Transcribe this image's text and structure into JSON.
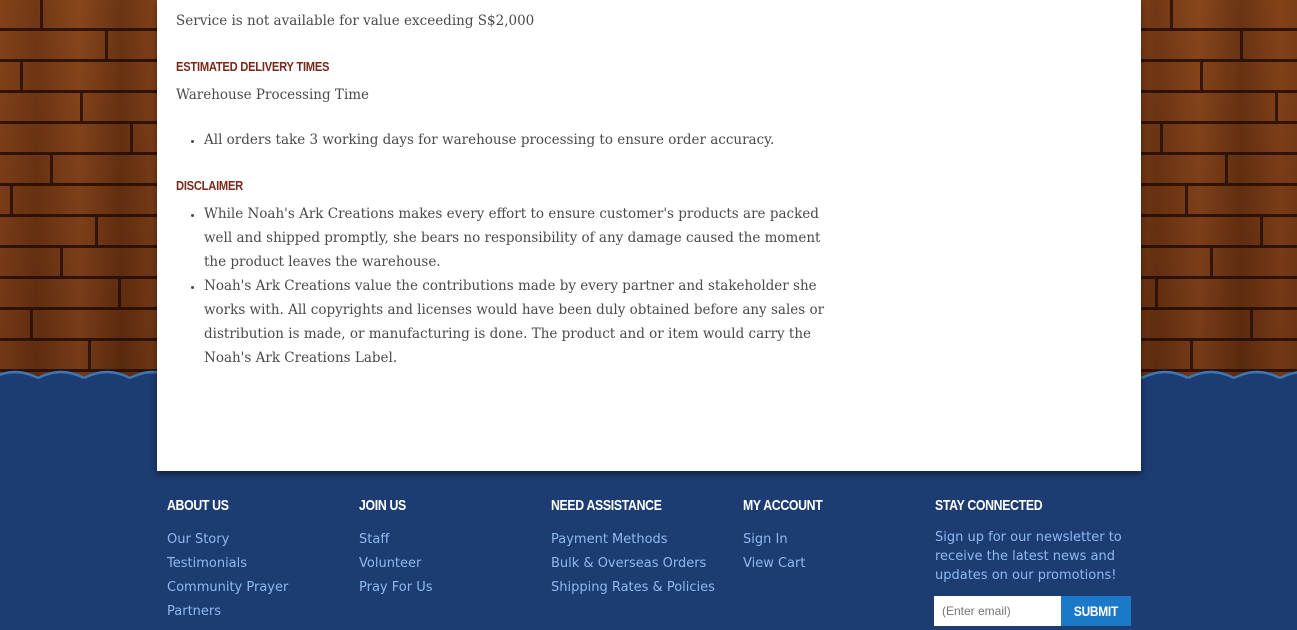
{
  "content": {
    "service_note": "Service is not available for value exceeding S$2,000",
    "delivery_heading": "ESTIMATED DELIVERY TIMES",
    "warehouse_label": "Warehouse Processing Time",
    "delivery_bullets": [
      "All orders take 3 working days for warehouse processing to ensure order accuracy."
    ],
    "disclaimer_heading": "DISCLAIMER",
    "disclaimer_bullets": [
      "While Noah's Ark Creations makes every effort to ensure customer's products are packed well and shipped promptly, she bears no responsibility of any damage caused the moment the product leaves the warehouse.",
      "Noah's Ark Creations value the contributions made by every partner and stakeholder she works with. All copyrights and licenses would have been duly obtained before any sales or distribution is made, or manufacturing is done. The product and or item would carry the Noah's Ark Creations Label."
    ]
  },
  "footer": {
    "about": {
      "title": "ABOUT US",
      "links": [
        "Our Story",
        "Testimonials",
        "Community Prayer",
        "Partners"
      ]
    },
    "join": {
      "title": "JOIN US",
      "links": [
        "Staff",
        "Volunteer",
        "Pray For Us"
      ]
    },
    "assistance": {
      "title": "NEED ASSISTANCE",
      "links": [
        "Payment Methods",
        "Bulk & Overseas Orders",
        "Shipping Rates & Policies"
      ]
    },
    "account": {
      "title": "MY ACCOUNT",
      "links": [
        "Sign In",
        "View Cart"
      ]
    },
    "connected": {
      "title": "STAY CONNECTED",
      "text": "Sign up for our newsletter to receive the latest news and updates on our promotions!",
      "email_placeholder": "(Enter email)",
      "submit_label": "SUBMIT"
    }
  },
  "colors": {
    "footer_bg": "#1c3c72",
    "link": "#8fb8f2",
    "heading": "#7a2a1b",
    "submit_bg": "#1a7ac8",
    "wood": "#6a3513"
  }
}
